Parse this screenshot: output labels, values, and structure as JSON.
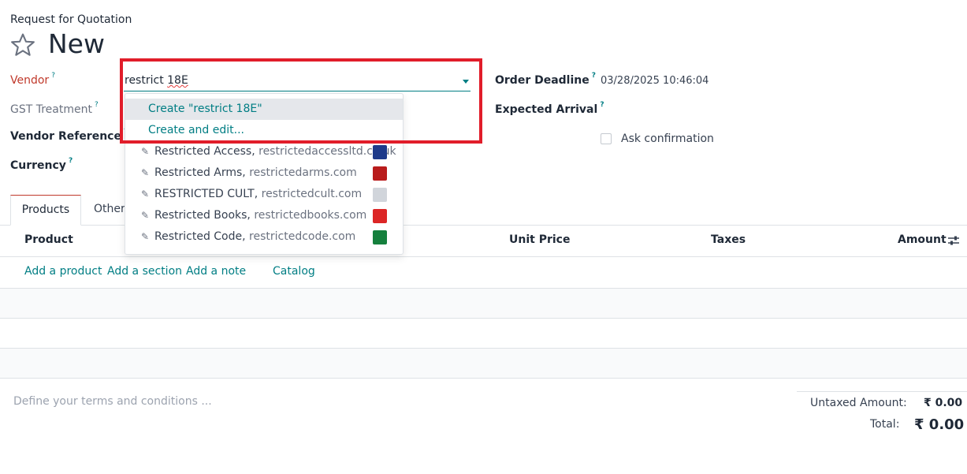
{
  "breadcrumb": "Request for Quotation",
  "title": "New",
  "icons": {
    "favorite": "star-icon",
    "dropdown": "caret-down-icon",
    "edit": "pencil-icon",
    "column_settings": "sliders-icon"
  },
  "fields": {
    "vendor": {
      "label": "Vendor",
      "help": "?",
      "value_typed": "restrict ",
      "value_misspelled": "18E"
    },
    "gst_treatment": {
      "label": "GST Treatment",
      "help": "?"
    },
    "vendor_reference": {
      "label": "Vendor Reference",
      "help": "?"
    },
    "currency": {
      "label": "Currency",
      "help": "?"
    },
    "order_deadline": {
      "label": "Order Deadline",
      "help": "?",
      "value": "03/28/2025 10:46:04"
    },
    "expected_arrival": {
      "label": "Expected Arrival",
      "help": "?"
    },
    "ask_confirmation": {
      "label": "Ask confirmation",
      "checked": false
    }
  },
  "dropdown": {
    "create_label": "Create \"restrict 18E\"",
    "create_edit_label": "Create and edit...",
    "partners": [
      {
        "name": "Restricted Access",
        "sep": ", ",
        "email": "restrictedaccessltd.co.uk",
        "color": "#1e3a8a"
      },
      {
        "name": "Restricted Arms",
        "sep": ", ",
        "email": "restrictedarms.com",
        "color": "#b91c1c"
      },
      {
        "name": "RESTRICTED CULT",
        "sep": ", ",
        "email": "restrictedcult.com",
        "color": "#d1d5db"
      },
      {
        "name": "Restricted Books",
        "sep": ", ",
        "email": "restrictedbooks.com",
        "color": "#dc2626"
      },
      {
        "name": "Restricted Code",
        "sep": ", ",
        "email": "restrictedcode.com",
        "color": "#15803d"
      }
    ]
  },
  "tabs": [
    {
      "label": "Products"
    },
    {
      "label": "Other"
    }
  ],
  "table": {
    "headers": {
      "product": "Product",
      "unit_price": "Unit Price",
      "taxes": "Taxes",
      "amount": "Amount"
    },
    "links": {
      "add_product": "Add a product",
      "add_section": "Add a section",
      "add_note": "Add a note",
      "catalog": "Catalog"
    }
  },
  "terms_placeholder": "Define your terms and conditions ...",
  "totals": {
    "untaxed_label": "Untaxed Amount:",
    "untaxed_value": "₹ 0.00",
    "total_label": "Total:",
    "total_value": "₹ 0.00"
  },
  "colors": {
    "accent": "#017e84",
    "required": "#c0392b",
    "highlight": "#e11d2a"
  }
}
